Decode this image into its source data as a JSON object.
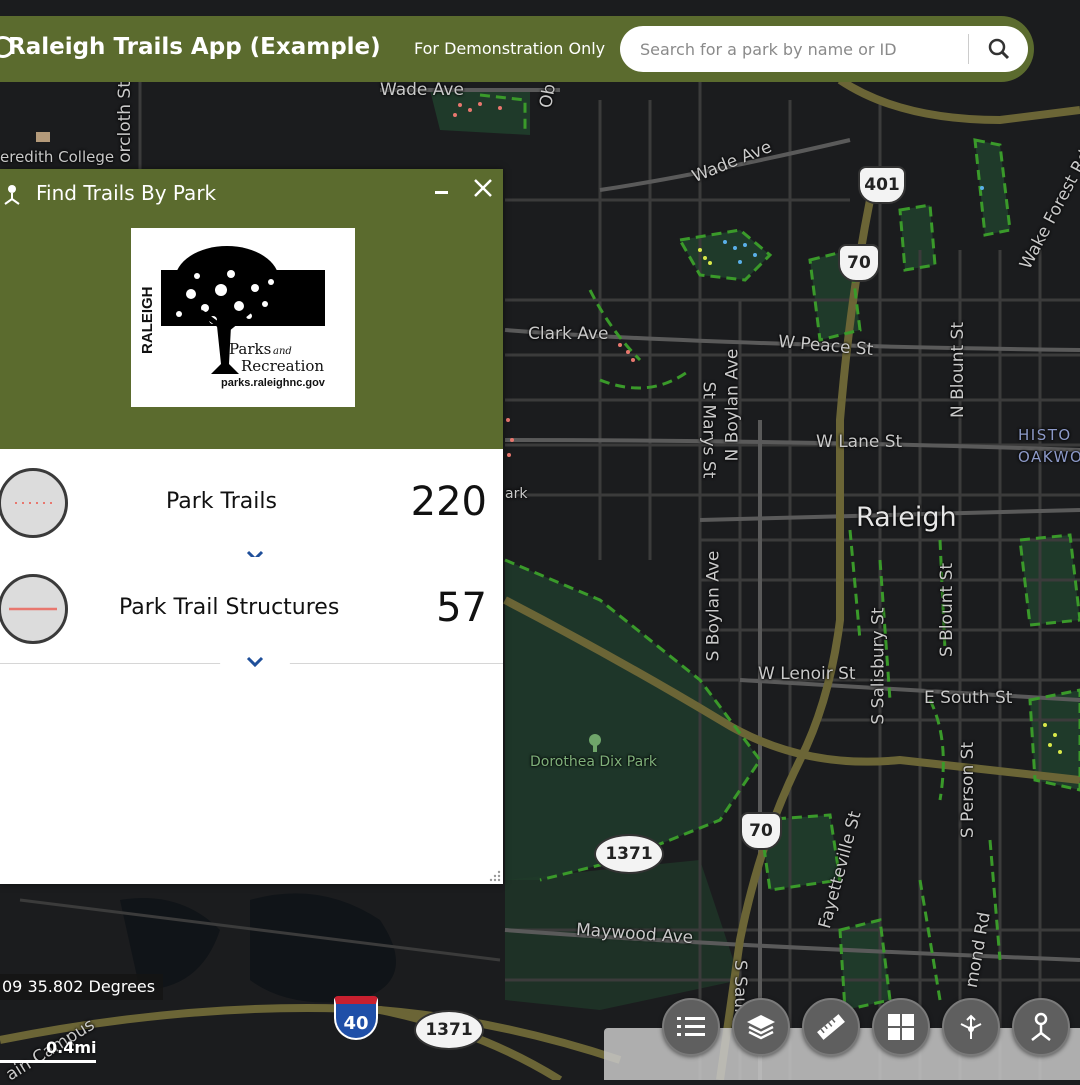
{
  "header": {
    "title": "Raleigh Trails App (Example)",
    "subtitle": "For Demonstration Only",
    "search_placeholder": "Search for a park by name or ID"
  },
  "panel": {
    "title": "Find Trails By Park",
    "logo": {
      "vertical_text": "RALEIGH",
      "wordmark_parks": "Parks",
      "wordmark_and": "and",
      "wordmark_recreation": "Recreation",
      "url": "parks.raleighnc.gov"
    },
    "layers": [
      {
        "name": "Park Trails",
        "count": "220",
        "swatch_style": "dotted",
        "swatch_color": "#e8776e"
      },
      {
        "name": "Park Trail Structures",
        "count": "57",
        "swatch_style": "solid",
        "swatch_color": "#e8776e"
      }
    ]
  },
  "map": {
    "labels": {
      "wade_ave_top": "Wade Ave",
      "wade_ave_right": "Wade Ave",
      "meredith_college": "eredith College",
      "clark_ave": "Clark Ave",
      "w_peace_st": "W Peace St",
      "w_lane_st": "W Lane St",
      "st_marys_st": "St Marys St",
      "n_boylan_ave": "N Boylan Ave",
      "n_blount_st": "N Blount St",
      "historic_oakwood": "HISTO\nOAKWO",
      "raleigh": "Raleigh",
      "s_boylan_ave": "S Boylan Ave",
      "w_lenoir_st": "W Lenoir St",
      "s_salisbury_st": "S Salisbury St",
      "s_blount_st": "S Blount St",
      "e_south_st": "E South St",
      "s_person_st": "S Person St",
      "dorothea_dix_park": "Dorothea Dix Park",
      "fayetteville_st": "Fayetteville St",
      "maywood_ave": "Maywood Ave",
      "s_saunders": "S Saunde",
      "wake_forest_rd": "Wake Forest Rd",
      "hammond_rd": "mond Rd",
      "oberlin": "Ob",
      "gorcloth_st": "orcloth St",
      "park_fragment": "ark",
      "main_campus": "ain Campus"
    },
    "shields": {
      "us_401": "401",
      "nc_70_top": "70",
      "nc_70_bottom": "70",
      "sr_1371_mid": "1371",
      "sr_1371_bottom": "1371",
      "i_40": "40"
    },
    "coordinates": "09 35.802 Degrees",
    "scale": "0.4mi"
  },
  "toolbar": {
    "tools": [
      "list-icon",
      "layers-icon",
      "measure-icon",
      "basemap-gallery-icon",
      "share-icon",
      "trail-finder-icon"
    ]
  },
  "colors": {
    "brand_green": "#5b6b2e",
    "map_background": "#1b1c1e",
    "park_fill": "#1f3a2a",
    "trail_green": "#3a9a2a",
    "trail_red": "#e8776e"
  }
}
